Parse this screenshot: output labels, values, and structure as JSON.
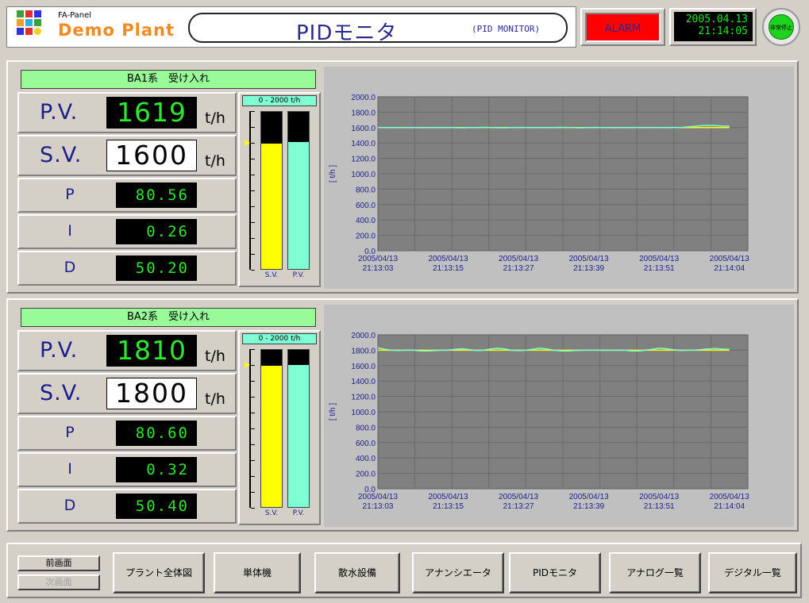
{
  "header": {
    "brand_small": "FA-Panel",
    "brand_name": "Demo Plant",
    "title": "PIDモニタ",
    "subtitle": "(PID MONITOR)",
    "alarm_label": "ALARM",
    "date": "2005.04.13",
    "time": "21:14:05",
    "estop_label": "非常停止"
  },
  "colors": {
    "alarm": "#ff0000",
    "pv_digits": "#2ee82e",
    "sv_bar": "#ffff00",
    "pv_bar": "#7fffd4",
    "title_text": "#2a2a90",
    "panel_bg": "#d4d0c8"
  },
  "sections": [
    {
      "title": "BA1系　受け入れ",
      "pv_label": "P.V.",
      "pv_value": "1619",
      "sv_label": "S.V.",
      "sv_value": "1600",
      "unit": "t/h",
      "p_label": "P",
      "p_value": "80.56",
      "i_label": "I",
      "i_value": "0.26",
      "d_label": "D",
      "d_value": "50.20",
      "bar_range": "0 - 2000 t/h",
      "sv_bar_label": "S.V.",
      "pv_bar_label": "P.V.",
      "sv_fraction": 0.8,
      "pv_fraction": 0.8095
    },
    {
      "title": "BA2系　受け入れ",
      "pv_label": "P.V.",
      "pv_value": "1810",
      "sv_label": "S.V.",
      "sv_value": "1800",
      "unit": "t/h",
      "p_label": "P",
      "p_value": "80.60",
      "i_label": "I",
      "i_value": "0.32",
      "d_label": "D",
      "d_value": "50.40",
      "bar_range": "0 - 2000 t/h",
      "sv_bar_label": "S.V.",
      "pv_bar_label": "P.V.",
      "sv_fraction": 0.9,
      "pv_fraction": 0.905
    }
  ],
  "chart_data": [
    {
      "type": "line",
      "ylabel": "[ t/h ]",
      "ylim": [
        0,
        2000
      ],
      "yticks": [
        "2000.0",
        "1800.0",
        "1600.0",
        "1400.0",
        "1200.0",
        "1000.0",
        "800.0",
        "600.0",
        "400.0",
        "200.0",
        "0.0"
      ],
      "xticks": [
        {
          "date": "2005/04/13",
          "time": "21:13:03"
        },
        {
          "date": "2005/04/13",
          "time": "21:13:15"
        },
        {
          "date": "2005/04/13",
          "time": "21:13:27"
        },
        {
          "date": "2005/04/13",
          "time": "21:13:39"
        },
        {
          "date": "2005/04/13",
          "time": "21:13:51"
        },
        {
          "date": "2005/04/13",
          "time": "21:14:04"
        }
      ],
      "grid": true,
      "series": [
        {
          "color": "#ffff00",
          "values": [
            1600,
            1600,
            1600,
            1600,
            1600,
            1600,
            1600,
            1600,
            1600,
            1600,
            1600,
            1600,
            1600,
            1600,
            1600,
            1600,
            1600,
            1600,
            1600,
            1600,
            1600,
            1600,
            1600,
            1600,
            1600,
            1600,
            1600,
            1600,
            1600,
            1600,
            1600,
            1600,
            1600,
            1600,
            1600,
            1600,
            1600,
            1600,
            1600,
            1600,
            1600,
            1600,
            1600,
            1600,
            1600,
            1600,
            1600,
            1600,
            1600,
            1600,
            1600
          ]
        },
        {
          "color": "#7fffd4",
          "values": [
            1600,
            1601,
            1600,
            1599,
            1600,
            1601,
            1599,
            1600,
            1601,
            1602,
            1600,
            1599,
            1598,
            1600,
            1601,
            1603,
            1601,
            1599,
            1598,
            1600,
            1602,
            1601,
            1600,
            1599,
            1600,
            1601,
            1603,
            1600,
            1599,
            1598,
            1600,
            1602,
            1601,
            1600,
            1599,
            1600,
            1601,
            1602,
            1600,
            1599,
            1600,
            1601,
            1602,
            1600,
            1608,
            1615,
            1625,
            1628,
            1626,
            1620,
            1619
          ]
        }
      ]
    },
    {
      "type": "line",
      "ylabel": "[ t/h ]",
      "ylim": [
        0,
        2000
      ],
      "yticks": [
        "2000.0",
        "1800.0",
        "1600.0",
        "1400.0",
        "1200.0",
        "1000.0",
        "800.0",
        "600.0",
        "400.0",
        "200.0",
        "0.0"
      ],
      "xticks": [
        {
          "date": "2005/04/13",
          "time": "21:13:03"
        },
        {
          "date": "2005/04/13",
          "time": "21:13:15"
        },
        {
          "date": "2005/04/13",
          "time": "21:13:27"
        },
        {
          "date": "2005/04/13",
          "time": "21:13:39"
        },
        {
          "date": "2005/04/13",
          "time": "21:13:51"
        },
        {
          "date": "2005/04/13",
          "time": "21:14:04"
        }
      ],
      "grid": true,
      "series": [
        {
          "color": "#ffff00",
          "values": [
            1800,
            1800,
            1800,
            1800,
            1800,
            1800,
            1800,
            1800,
            1800,
            1800,
            1800,
            1800,
            1800,
            1800,
            1800,
            1800,
            1800,
            1800,
            1800,
            1800,
            1800,
            1800,
            1800,
            1800,
            1800,
            1800,
            1800,
            1800,
            1800,
            1800,
            1800,
            1800,
            1800,
            1800,
            1800,
            1800,
            1800,
            1800,
            1800,
            1800,
            1800,
            1800,
            1800,
            1800,
            1800,
            1800,
            1800,
            1800,
            1800,
            1800,
            1800
          ]
        },
        {
          "color": "#7fffd4",
          "values": [
            1830,
            1812,
            1800,
            1798,
            1800,
            1801,
            1792,
            1790,
            1795,
            1800,
            1802,
            1812,
            1820,
            1808,
            1796,
            1800,
            1815,
            1825,
            1816,
            1800,
            1795,
            1800,
            1812,
            1826,
            1818,
            1800,
            1792,
            1790,
            1796,
            1800,
            1802,
            1801,
            1800,
            1799,
            1800,
            1801,
            1792,
            1790,
            1800,
            1812,
            1826,
            1820,
            1806,
            1798,
            1800,
            1802,
            1808,
            1818,
            1822,
            1814,
            1810
          ]
        }
      ]
    }
  ],
  "nav": {
    "prev_screen": "前画面",
    "next_screen": "次画面",
    "buttons": [
      "プラント全体図",
      "単体機",
      "散水設備",
      "アナンシエータ",
      "PIDモニタ",
      "アナログ一覧",
      "デジタル一覧"
    ]
  }
}
